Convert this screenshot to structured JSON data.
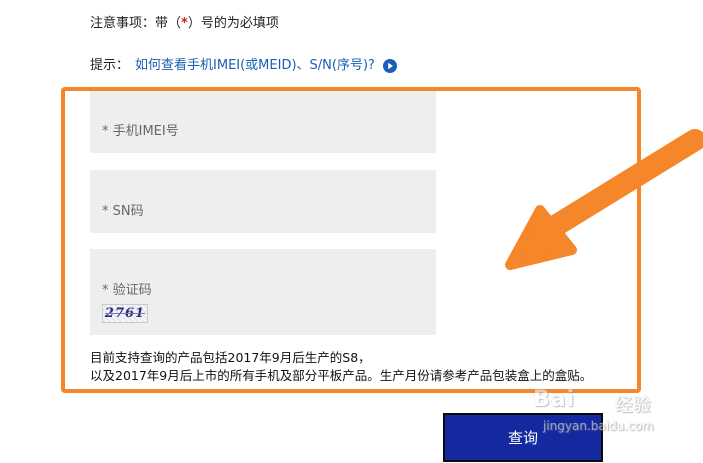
{
  "notice": {
    "prefix": "注意事项：带（",
    "required_mark": "*",
    "suffix": "）号的为必填项"
  },
  "hint": {
    "label": "提示：",
    "link_text": "如何查看手机IMEI(或MEID)、S/N(序号)?"
  },
  "fields": {
    "imei_placeholder": "* 手机IMEI号",
    "sn_placeholder": "* SN码",
    "captcha_placeholder": "* 验证码",
    "captcha_code": "2761"
  },
  "support": {
    "line1": "目前支持查询的产品包括2017年9月后生产的S8，",
    "line2": "以及2017年9月后上市的所有手机及部分平板产品。生产月份请参考产品包装盒上的盒贴。"
  },
  "query_button": {
    "label": "查询"
  },
  "watermark": {
    "logo": "Bai",
    "logo_suffix": "经验",
    "url": "jingyan.baidu.com"
  },
  "colors": {
    "highlight": "#f5862a",
    "button": "#1428a0",
    "link": "#1a5fb4",
    "required": "#d4181f"
  }
}
